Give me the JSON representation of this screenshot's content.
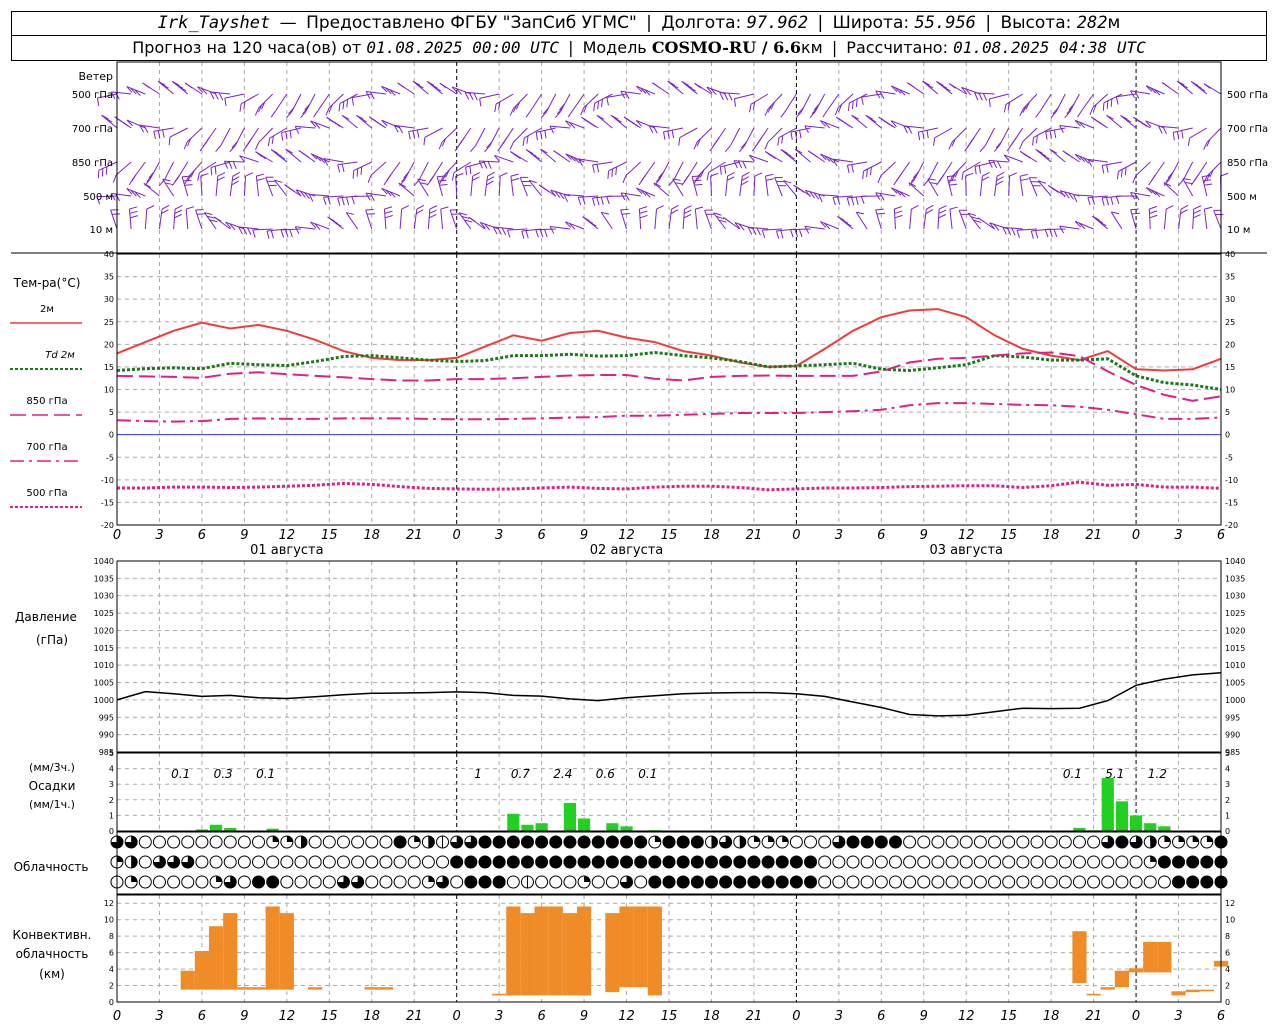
{
  "header": {
    "station": "Irk_Tayshet",
    "dash": "—",
    "provider": "Предоставлено ФГБУ \"ЗапСиб УГМС\"",
    "lon_label": "Долгота:",
    "lon_value": "97.962",
    "lat_label": "Широта:",
    "lat_value": "55.956",
    "alt_label": "Высота:",
    "alt_value": "282",
    "alt_unit": "м",
    "forecast_label": "Прогноз на 120 часа(ов)",
    "from_label": "от",
    "forecast_start": "01.08.2025 00:00 UTC",
    "model_label": "Модель",
    "model_name": "COSMO-RU / 6.6",
    "model_unit": "км",
    "calc_label": "Рассчитано:",
    "calc_time": "01.08.2025 04:38 UTC"
  },
  "chart_data": [
    {
      "type": "wind",
      "panel": "wind",
      "title": "Ветер",
      "levels": [
        "500 гПа",
        "700 гПа",
        "850 гПа",
        "500 м",
        "10 м"
      ],
      "barb_color": "#7b22c8"
    },
    {
      "type": "line",
      "panel": "temperature",
      "ylabel": "Тем-ра(°C)",
      "ylim": [
        -20,
        40
      ],
      "yticks": [
        -20,
        -15,
        -10,
        -5,
        0,
        5,
        10,
        15,
        20,
        25,
        30,
        35,
        40
      ],
      "x_hours": [
        0,
        6,
        12,
        18,
        24,
        30,
        36,
        42,
        48,
        54,
        60,
        66,
        72,
        78,
        84,
        90,
        96,
        102,
        108,
        114,
        120,
        126,
        132,
        138,
        144,
        150,
        156,
        162,
        168,
        174
      ],
      "series": [
        {
          "name": "2м",
          "color": "#f03c3c",
          "style": "solid",
          "values": [
            18,
            20.5,
            23,
            24.8,
            23.5,
            24.3,
            23,
            21,
            18.5,
            17,
            16.5,
            16.5,
            17,
            19.5,
            22,
            20.8,
            22.5,
            23,
            21.5,
            20.5,
            18.5,
            17.5,
            16,
            15,
            15.2,
            19,
            23,
            26,
            27.5,
            27.8,
            26,
            22,
            19,
            17.5,
            16.5,
            18.5,
            14.5,
            14.2,
            14.5,
            16.8
          ]
        },
        {
          "name": "Td 2м",
          "color": "#1a7a1a",
          "style": "dotted",
          "values": [
            14.2,
            14.6,
            14.8,
            14.6,
            15.8,
            15.5,
            15.3,
            16.2,
            17.3,
            17.5,
            17,
            16.5,
            16.2,
            16.4,
            17.5,
            17.5,
            17.8,
            17.4,
            17.5,
            18.2,
            17.5,
            17,
            16.2,
            15,
            15.2,
            15.5,
            15.8,
            14.5,
            14.2,
            14.8,
            15.5,
            17.5,
            17.2,
            16.5,
            16.5,
            16.8,
            13,
            11.5,
            11,
            10
          ]
        },
        {
          "name": "850 гПа",
          "color": "#e0208a",
          "style": "longdash",
          "values": [
            13,
            12.9,
            12.8,
            12.6,
            13.5,
            13.8,
            13.4,
            13,
            12.7,
            12.3,
            12,
            12,
            12.3,
            12.3,
            12.5,
            12.8,
            13.1,
            13.2,
            13.2,
            12.4,
            12,
            12.8,
            13,
            13.1,
            13,
            13,
            13,
            14,
            16,
            16.8,
            17,
            17.5,
            18,
            18.2,
            17.4,
            14,
            11,
            8.8,
            7.5,
            8.5
          ]
        },
        {
          "name": "700 гПа",
          "color": "#e0208a",
          "style": "dashdot",
          "values": [
            3.2,
            3,
            2.9,
            3,
            3.5,
            3.6,
            3.5,
            3.5,
            3.6,
            3.6,
            3.6,
            3.5,
            3.4,
            3.4,
            3.5,
            3.6,
            3.8,
            3.9,
            4.2,
            4.2,
            4.4,
            4.6,
            4.8,
            4.8,
            4.8,
            5,
            5.2,
            5.5,
            6.5,
            7,
            7,
            6.8,
            6.6,
            6.5,
            6.2,
            5.5,
            4.5,
            3.5,
            3.5,
            3.8
          ]
        },
        {
          "name": "500 гПа",
          "color": "#e0208a",
          "style": "dotted",
          "values": [
            -11.8,
            -11.8,
            -11.6,
            -11.6,
            -11.7,
            -11.6,
            -11.4,
            -11.2,
            -10.8,
            -11,
            -11.5,
            -11.9,
            -12,
            -12.1,
            -12,
            -11.8,
            -11.6,
            -11.9,
            -12,
            -11.6,
            -11.4,
            -11.4,
            -11.7,
            -12.2,
            -12,
            -11.8,
            -11.8,
            -11.7,
            -11.5,
            -11.4,
            -11.3,
            -11.3,
            -11.7,
            -11.3,
            -10.5,
            -11.2,
            -11,
            -11.6,
            -11.6,
            -11.9
          ]
        }
      ],
      "zero_line_color": "#3a3aee"
    },
    {
      "type": "line",
      "panel": "pressure",
      "ylabel": "Давление",
      "ylabel2": "(гПа)",
      "ylim": [
        985,
        1040
      ],
      "yticks": [
        985,
        990,
        995,
        1000,
        1005,
        1010,
        1015,
        1020,
        1025,
        1030,
        1035,
        1040
      ],
      "series": [
        {
          "name": "Давление",
          "color": "#000000",
          "values": [
            1000,
            1002.4,
            1001.8,
            1001,
            1001.3,
            1000.6,
            1000.4,
            1000.9,
            1001.5,
            1001.9,
            1002,
            1002.1,
            1002.3,
            1002.1,
            1001.3,
            1001.1,
            1000.3,
            999.8,
            1000.6,
            1001.2,
            1001.8,
            1002,
            1002.1,
            1002.1,
            1001.8,
            1001,
            999.4,
            997.8,
            995.8,
            995.4,
            995.6,
            996.6,
            997.6,
            997.5,
            997.6,
            999.8,
            1004.2,
            1006,
            1007.2,
            1007.8
          ]
        }
      ]
    },
    {
      "type": "bar",
      "panel": "precipitation",
      "ylabel_top": "(мм/3ч.)",
      "ylabel": "Осадки",
      "ylabel_bottom": "(мм/1ч.)",
      "ylim": [
        0,
        5
      ],
      "yticks": [
        0,
        1,
        2,
        3,
        4,
        5
      ],
      "color": "#22d022",
      "hourly": [
        [
          6,
          0.1
        ],
        [
          7,
          0.4
        ],
        [
          8,
          0.2
        ],
        [
          11,
          0.15
        ],
        [
          28,
          1.1
        ],
        [
          29,
          0.4
        ],
        [
          30,
          0.5
        ],
        [
          32,
          1.8
        ],
        [
          33,
          0.8
        ],
        [
          35,
          0.5
        ],
        [
          36,
          0.3
        ],
        [
          38,
          0.05
        ],
        [
          68,
          0.2
        ],
        [
          69,
          0.05
        ],
        [
          70,
          3.4
        ],
        [
          71,
          1.9
        ],
        [
          72,
          1.0
        ],
        [
          73,
          0.5
        ],
        [
          74,
          0.3
        ]
      ],
      "three_hour_labels": [
        {
          "x": 4.5,
          "text": "0.1"
        },
        {
          "x": 7.5,
          "text": "0.3"
        },
        {
          "x": 10.5,
          "text": "0.1"
        },
        {
          "x": 25.5,
          "text": "1"
        },
        {
          "x": 28.5,
          "text": "0.7"
        },
        {
          "x": 31.5,
          "text": "2.4"
        },
        {
          "x": 34.5,
          "text": "0.6"
        },
        {
          "x": 37.5,
          "text": "0.1"
        },
        {
          "x": 67.5,
          "text": "0.1"
        },
        {
          "x": 70.5,
          "text": "5.1"
        },
        {
          "x": 73.5,
          "text": "1.2"
        }
      ]
    },
    {
      "type": "table",
      "panel": "cloudiness",
      "ylabel": "Облачность",
      "rows": [
        "abcccccccccddlccccccmfeiabmmmmmmmmmmmmdmmmeaefffcccbmmmmccccccccccccccbmaefffdmmmmmmmmmff",
        "dlcbbbccccccccccccccccccmmmmmmmmmmmmmmmmmmmmmmmmmmcccccccccccccccccccccccdmmmmmmmmmmmmbmmm",
        "cfcccccfbcmmccccbbccccfbcmmmcicccfccbcmmmmmmmmmmmmcccccccccccccccccccccccccmmmmmmmmmmmmmm"
      ]
    },
    {
      "type": "bar",
      "panel": "convective",
      "ylabel": "Конвективн.",
      "ylabel2": "облачность",
      "ylabel3": "(км)",
      "ylim": [
        0,
        13
      ],
      "yticks": [
        0,
        2,
        4,
        6,
        8,
        10,
        12
      ],
      "color": "#f08c28",
      "bars": [
        [
          5,
          1.5,
          3.8
        ],
        [
          6,
          1.5,
          6.2
        ],
        [
          7,
          1.5,
          9.2
        ],
        [
          8,
          1.5,
          10.8
        ],
        [
          9,
          1.5,
          1.8
        ],
        [
          10,
          1.5,
          1.8
        ],
        [
          11,
          1.5,
          11.6
        ],
        [
          12,
          1.5,
          10.8
        ],
        [
          14,
          1.5,
          1.8
        ],
        [
          18,
          1.5,
          1.8
        ],
        [
          19,
          1.5,
          1.8
        ],
        [
          27,
          0.8,
          1.0
        ],
        [
          28,
          0.8,
          11.6
        ],
        [
          29,
          0.8,
          10.8
        ],
        [
          30,
          0.8,
          11.6
        ],
        [
          31,
          0.8,
          11.6
        ],
        [
          32,
          0.8,
          10.8
        ],
        [
          33,
          0.8,
          11.6
        ],
        [
          35,
          1.2,
          10.8
        ],
        [
          36,
          1.8,
          11.6
        ],
        [
          37,
          1.8,
          11.6
        ],
        [
          38,
          0.8,
          11.6
        ],
        [
          68,
          2.3,
          8.6
        ],
        [
          69,
          0.8,
          1.0
        ],
        [
          70,
          1.5,
          1.8
        ],
        [
          71,
          1.8,
          3.8
        ],
        [
          72,
          3.6,
          4.1
        ],
        [
          73,
          3.6,
          7.3
        ],
        [
          74,
          3.6,
          7.3
        ],
        [
          75,
          0.8,
          1.3
        ],
        [
          76,
          1.2,
          1.5
        ],
        [
          77,
          1.3,
          1.5
        ],
        [
          78,
          4.3,
          5.0
        ]
      ]
    }
  ],
  "x_axis": {
    "hour_labels": [
      "0",
      "3",
      "6",
      "9",
      "12",
      "15",
      "18",
      "21"
    ],
    "final_label": "6",
    "day_labels": [
      "01 августа",
      "02 августа",
      "03 августа"
    ]
  }
}
